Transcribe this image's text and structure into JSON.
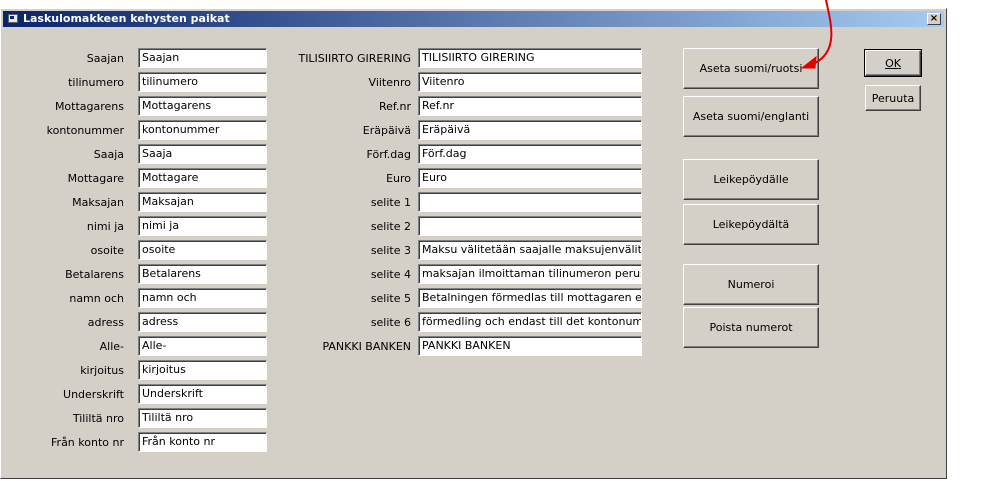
{
  "window": {
    "title": "Laskulomakkeen kehysten paikat",
    "close_label": "×"
  },
  "left_fields": [
    {
      "label": "Saajan",
      "value": "Saajan"
    },
    {
      "label": "tilinumero",
      "value": "tilinumero"
    },
    {
      "label": "Mottagarens",
      "value": "Mottagarens"
    },
    {
      "label": "kontonummer",
      "value": "kontonummer"
    },
    {
      "label": "Saaja",
      "value": "Saaja"
    },
    {
      "label": "Mottagare",
      "value": "Mottagare"
    },
    {
      "label": "Maksajan",
      "value": "Maksajan"
    },
    {
      "label": "nimi ja",
      "value": "nimi ja"
    },
    {
      "label": "osoite",
      "value": "osoite"
    },
    {
      "label": "Betalarens",
      "value": "Betalarens"
    },
    {
      "label": "namn och",
      "value": "namn och"
    },
    {
      "label": "adress",
      "value": "adress"
    },
    {
      "label": "Alle-",
      "value": "Alle-"
    },
    {
      "label": "kirjoitus",
      "value": "kirjoitus"
    },
    {
      "label": "Underskrift",
      "value": "Underskrift"
    },
    {
      "label": "Tililtä nro",
      "value": "Tililtä nro"
    },
    {
      "label": "Från konto nr",
      "value": "Från konto nr"
    }
  ],
  "right_fields": [
    {
      "label": "TILISIIRTO GIRERING",
      "value": "TILISIIRTO GIRERING"
    },
    {
      "label": "Viitenro",
      "value": "Viitenro"
    },
    {
      "label": "Ref.nr",
      "value": "Ref.nr"
    },
    {
      "label": "Eräpäivä",
      "value": "Eräpäivä"
    },
    {
      "label": "Förf.dag",
      "value": "Förf.dag"
    },
    {
      "label": "Euro",
      "value": "Euro"
    },
    {
      "label": "selite 1",
      "value": ""
    },
    {
      "label": "selite 2",
      "value": ""
    },
    {
      "label": "selite 3",
      "value": "Maksu välitetään saajalle maksujenvälityksen"
    },
    {
      "label": "selite 4",
      "value": "maksajan ilmoittaman tilinumeron perusteella"
    },
    {
      "label": "selite 5",
      "value": "Betalningen förmedlas till mottagaren enligt vill"
    },
    {
      "label": "selite 6",
      "value": "förmedling och endast till det kontonummer bet"
    },
    {
      "label": "PANKKI BANKEN",
      "value": "PANKKI BANKEN"
    }
  ],
  "buttons": {
    "set_fi_sv": "Aseta suomi/ruotsi",
    "set_fi_en": "Aseta suomi/englanti",
    "to_clipboard": "Leikepöydälle",
    "from_clipboard": "Leikepöydältä",
    "number": "Numeroi",
    "remove_numbers": "Poista numerot",
    "ok": "OK",
    "cancel": "Peruuta"
  },
  "annotation": {
    "arrow_color": "#e00000"
  }
}
